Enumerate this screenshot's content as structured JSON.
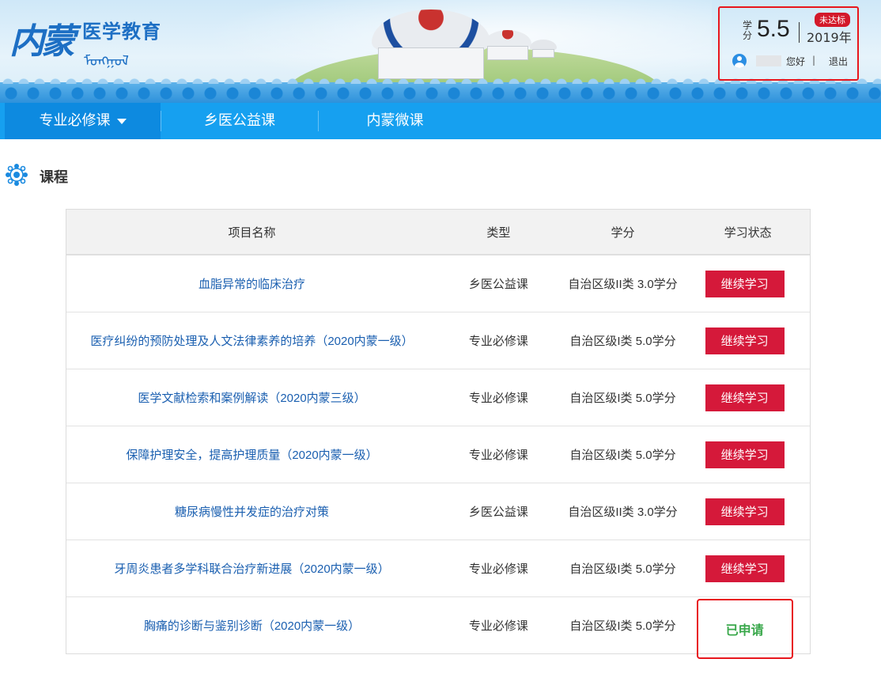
{
  "header": {
    "logo_big": "内蒙",
    "logo_title": "医学教育",
    "logo_script": "ᠮᠣᠩᠭᠣᠯ",
    "credit_label": "学分",
    "credit_value": "5.5",
    "year": "2019年",
    "status_badge": "未达标",
    "greeting": "您好",
    "separator": "|",
    "logout": "退出"
  },
  "nav": {
    "items": [
      {
        "label": "专业必修课"
      },
      {
        "label": "乡医公益课"
      },
      {
        "label": "内蒙微课"
      }
    ]
  },
  "section": {
    "title": "课程"
  },
  "table": {
    "headers": [
      "项目名称",
      "类型",
      "学分",
      "学习状态"
    ],
    "rows": [
      {
        "name": "血脂异常的临床治疗",
        "type": "乡医公益课",
        "credit": "自治区级II类 3.0学分",
        "status": "继续学习"
      },
      {
        "name": "医疗纠纷的预防处理及人文法律素养的培养（2020内蒙一级）",
        "type": "专业必修课",
        "credit": "自治区级I类 5.0学分",
        "status": "继续学习"
      },
      {
        "name": "医学文献检索和案例解读（2020内蒙三级）",
        "type": "专业必修课",
        "credit": "自治区级I类 5.0学分",
        "status": "继续学习"
      },
      {
        "name": "保障护理安全，提高护理质量（2020内蒙一级）",
        "type": "专业必修课",
        "credit": "自治区级I类 5.0学分",
        "status": "继续学习"
      },
      {
        "name": "糖尿病慢性并发症的治疗对策",
        "type": "乡医公益课",
        "credit": "自治区级II类 3.0学分",
        "status": "继续学习"
      },
      {
        "name": "牙周炎患者多学科联合治疗新进展（2020内蒙一级）",
        "type": "专业必修课",
        "credit": "自治区级I类 5.0学分",
        "status": "继续学习"
      },
      {
        "name": "胸痛的诊断与鉴别诊断（2020内蒙一级）",
        "type": "专业必修课",
        "credit": "自治区级I类 5.0学分",
        "status": "已申请"
      }
    ]
  },
  "colors": {
    "nav_bg": "#16a0f0",
    "button_red": "#d5193a",
    "link_blue": "#1a5fb0",
    "applied_green": "#3aa84b",
    "highlight_red": "#e8161d"
  }
}
